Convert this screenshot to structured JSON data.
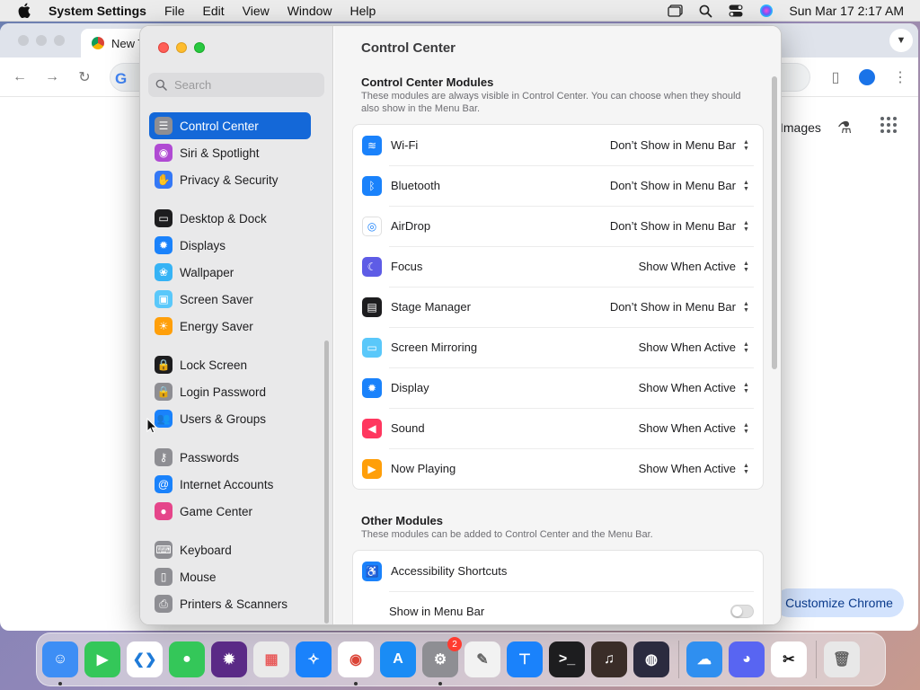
{
  "menubar": {
    "app_name": "System Settings",
    "menus": [
      "File",
      "Edit",
      "View",
      "Window",
      "Help"
    ],
    "clock": "Sun Mar 17  2:17 AM"
  },
  "chrome": {
    "tab_title": "New T",
    "images_link": "Images",
    "customize_label": "Customize Chrome"
  },
  "settings": {
    "search_placeholder": "Search",
    "sidebar": {
      "group1": [
        {
          "label": "Control Center",
          "icon": "control-center-icon",
          "color": "#8e8e93",
          "selected": true
        },
        {
          "label": "Siri & Spotlight",
          "icon": "siri-icon",
          "color": "#b04ad3"
        },
        {
          "label": "Privacy & Security",
          "icon": "hand-icon",
          "color": "#3478f6"
        }
      ],
      "group2": [
        {
          "label": "Desktop & Dock",
          "icon": "dock-icon",
          "color": "#1d1d1f"
        },
        {
          "label": "Displays",
          "icon": "sun-icon",
          "color": "#1a82fb"
        },
        {
          "label": "Wallpaper",
          "icon": "flower-icon",
          "color": "#36b3f5"
        },
        {
          "label": "Screen Saver",
          "icon": "screensaver-icon",
          "color": "#5ac8fa"
        },
        {
          "label": "Energy Saver",
          "icon": "bulb-icon",
          "color": "#ff9f0a"
        }
      ],
      "group3": [
        {
          "label": "Lock Screen",
          "icon": "lock-icon",
          "color": "#1d1d1f"
        },
        {
          "label": "Login Password",
          "icon": "lock-icon",
          "color": "#8e8e93"
        },
        {
          "label": "Users & Groups",
          "icon": "users-icon",
          "color": "#1a82fb"
        }
      ],
      "group4": [
        {
          "label": "Passwords",
          "icon": "key-icon",
          "color": "#8e8e93"
        },
        {
          "label": "Internet Accounts",
          "icon": "at-icon",
          "color": "#1a82fb"
        },
        {
          "label": "Game Center",
          "icon": "game-center-icon",
          "color": "#e5458a"
        }
      ],
      "group5": [
        {
          "label": "Keyboard",
          "icon": "keyboard-icon",
          "color": "#8e8e93"
        },
        {
          "label": "Mouse",
          "icon": "mouse-icon",
          "color": "#8e8e93"
        },
        {
          "label": "Printers & Scanners",
          "icon": "printer-icon",
          "color": "#8e8e93"
        }
      ]
    },
    "content": {
      "title": "Control Center",
      "section1": {
        "heading": "Control Center Modules",
        "subtitle": "These modules are always visible in Control Center. You can choose when they should also show in the Menu Bar.",
        "modules": [
          {
            "label": "Wi-Fi",
            "value": "Don’t Show in Menu Bar",
            "icon": "wifi-icon",
            "color": "#1a82fb"
          },
          {
            "label": "Bluetooth",
            "value": "Don’t Show in Menu Bar",
            "icon": "bluetooth-icon",
            "color": "#1a82fb"
          },
          {
            "label": "AirDrop",
            "value": "Don’t Show in Menu Bar",
            "icon": "airdrop-icon",
            "color": "#ffffff"
          },
          {
            "label": "Focus",
            "value": "Show When Active",
            "icon": "moon-icon",
            "color": "#5e5ce6"
          },
          {
            "label": "Stage Manager",
            "value": "Don’t Show in Menu Bar",
            "icon": "stage-manager-icon",
            "color": "#1d1d1f"
          },
          {
            "label": "Screen Mirroring",
            "value": "Show When Active",
            "icon": "screen-mirroring-icon",
            "color": "#5ac8fa"
          },
          {
            "label": "Display",
            "value": "Show When Active",
            "icon": "sun-icon",
            "color": "#1a82fb"
          },
          {
            "label": "Sound",
            "value": "Show When Active",
            "icon": "speaker-icon",
            "color": "#ff375f"
          },
          {
            "label": "Now Playing",
            "value": "Show When Active",
            "icon": "play-icon",
            "color": "#ff9f0a"
          }
        ]
      },
      "section2": {
        "heading": "Other Modules",
        "subtitle": "These modules can be added to Control Center and the Menu Bar.",
        "modules": [
          {
            "label": "Accessibility Shortcuts",
            "icon": "accessibility-icon",
            "color": "#1a82fb"
          }
        ],
        "toggle_label": "Show in Menu Bar",
        "toggle_on": false
      }
    }
  },
  "dock": {
    "apps": [
      {
        "name": "finder-app",
        "glyph": "☺",
        "color": "#3d8ef5",
        "running": true
      },
      {
        "name": "facetime-app",
        "glyph": "▶",
        "color": "#34c759"
      },
      {
        "name": "vscode-app",
        "glyph": "❮❯",
        "color": "#ffffff",
        "fg": "#1f7bd8"
      },
      {
        "name": "messages-app",
        "glyph": "●",
        "color": "#34c759"
      },
      {
        "name": "firefox-app",
        "glyph": "✹",
        "color": "#5a2a86"
      },
      {
        "name": "launchpad-app",
        "glyph": "▦",
        "color": "#eaeaea",
        "fg": "#e85c5c"
      },
      {
        "name": "safari-app",
        "glyph": "✧",
        "color": "#1a82fb"
      },
      {
        "name": "chrome-app",
        "glyph": "◉",
        "color": "#ffffff",
        "fg": "#db4437",
        "running": true
      },
      {
        "name": "app-store-app",
        "glyph": "A",
        "color": "#1a8cf5"
      },
      {
        "name": "system-settings-app",
        "glyph": "⚙",
        "color": "#8e8e93",
        "badge": "2",
        "running": true
      },
      {
        "name": "textedit-app",
        "glyph": "✎",
        "color": "#f2f2f2",
        "fg": "#666"
      },
      {
        "name": "keynote-app",
        "glyph": "⊤",
        "color": "#1a82fb"
      },
      {
        "name": "terminal-app",
        "glyph": ">_",
        "color": "#1d1d1f"
      },
      {
        "name": "garageband-app",
        "glyph": "♫",
        "color": "#3a2d28"
      },
      {
        "name": "siri-app",
        "glyph": "◍",
        "color": "#2b2b3f"
      }
    ],
    "others": [
      {
        "name": "weather-app",
        "glyph": "☁",
        "color": "#2f8ff0"
      },
      {
        "name": "discord-app",
        "glyph": "◕",
        "color": "#5865f2"
      },
      {
        "name": "capcut-app",
        "glyph": "✂",
        "color": "#ffffff",
        "fg": "#111"
      }
    ],
    "trash": {
      "name": "trash",
      "glyph": "🗑",
      "color": "#e8e8e8"
    }
  }
}
